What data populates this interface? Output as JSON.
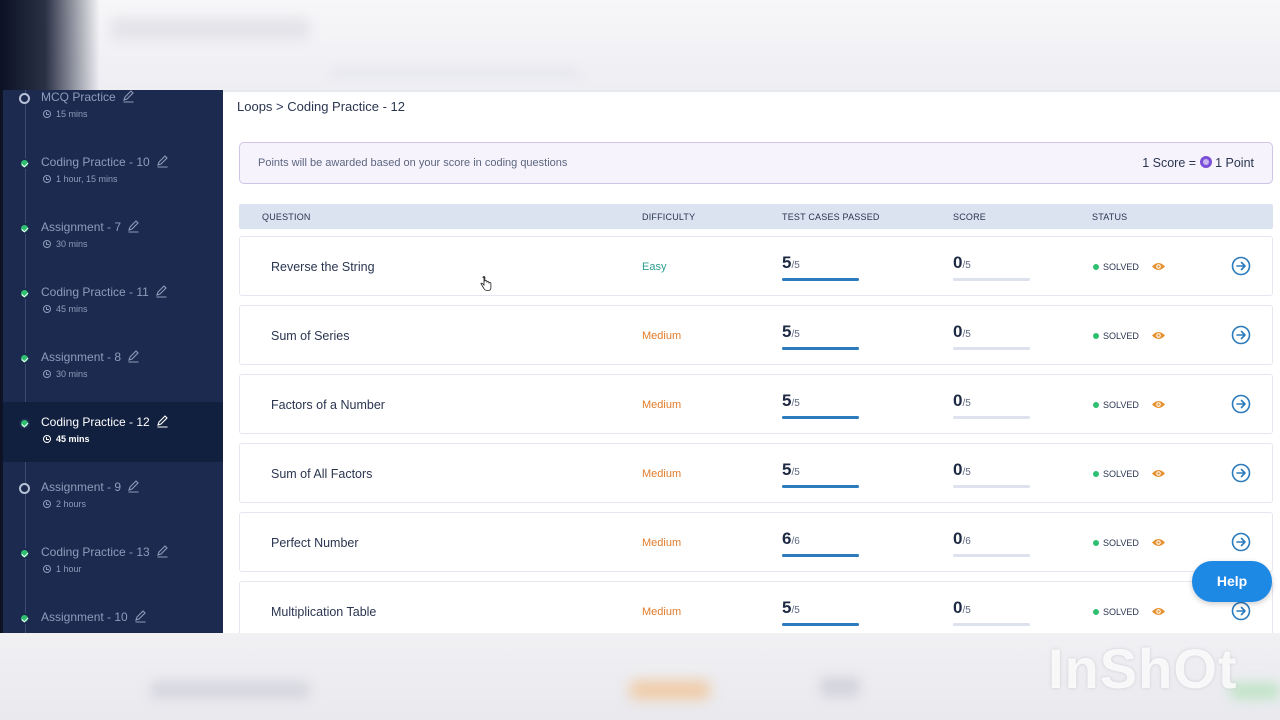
{
  "breadcrumb": "Loops > Coding Practice - 12",
  "banner": {
    "text": "Points will be awarded based on your score in coding questions",
    "score_label": "1 Score =",
    "point_label": "1 Point"
  },
  "sidebar": {
    "items": [
      {
        "title": "MCQ Practice",
        "duration": "15 mins",
        "status": "todo"
      },
      {
        "title": "Coding Practice - 10",
        "duration": "1 hour, 15 mins",
        "status": "done"
      },
      {
        "title": "Assignment - 7",
        "duration": "30 mins",
        "status": "done"
      },
      {
        "title": "Coding Practice - 11",
        "duration": "45 mins",
        "status": "done"
      },
      {
        "title": "Assignment - 8",
        "duration": "30 mins",
        "status": "done"
      },
      {
        "title": "Coding Practice - 12",
        "duration": "45 mins",
        "status": "done",
        "active": true
      },
      {
        "title": "Assignment - 9",
        "duration": "2 hours",
        "status": "todo"
      },
      {
        "title": "Coding Practice - 13",
        "duration": "1 hour",
        "status": "done"
      },
      {
        "title": "Assignment - 10",
        "duration": "",
        "status": "done"
      }
    ]
  },
  "table": {
    "headers": {
      "question": "QUESTION",
      "difficulty": "DIFFICULTY",
      "test_cases": "TEST CASES PASSED",
      "score": "SCORE",
      "status": "STATUS"
    },
    "rows": [
      {
        "name": "Reverse the String",
        "difficulty": "Easy",
        "passed": "5",
        "total": "/5",
        "score": "0",
        "score_total": "/5",
        "passed_fraction": 1.0,
        "score_fraction": 0,
        "status": "SOLVED"
      },
      {
        "name": "Sum of Series",
        "difficulty": "Medium",
        "passed": "5",
        "total": "/5",
        "score": "0",
        "score_total": "/5",
        "passed_fraction": 1.0,
        "score_fraction": 0,
        "status": "SOLVED"
      },
      {
        "name": "Factors of a Number",
        "difficulty": "Medium",
        "passed": "5",
        "total": "/5",
        "score": "0",
        "score_total": "/5",
        "passed_fraction": 1.0,
        "score_fraction": 0,
        "status": "SOLVED"
      },
      {
        "name": "Sum of All Factors",
        "difficulty": "Medium",
        "passed": "5",
        "total": "/5",
        "score": "0",
        "score_total": "/5",
        "passed_fraction": 1.0,
        "score_fraction": 0,
        "status": "SOLVED"
      },
      {
        "name": "Perfect Number",
        "difficulty": "Medium",
        "passed": "6",
        "total": "/6",
        "score": "0",
        "score_total": "/6",
        "passed_fraction": 1.0,
        "score_fraction": 0,
        "status": "SOLVED"
      },
      {
        "name": "Multiplication Table",
        "difficulty": "Medium",
        "passed": "5",
        "total": "/5",
        "score": "0",
        "score_total": "/5",
        "passed_fraction": 1.0,
        "score_fraction": 0,
        "status": "SOLVED"
      }
    ]
  },
  "help_label": "Help",
  "watermark": "InShOt",
  "colors": {
    "sidebar_bg": "#1b2a4e",
    "easy": "#2f9e8f",
    "medium": "#e07b2a",
    "solved": "#2fbf71",
    "progress": "#2b7bbd",
    "eye": "#e6912f",
    "help": "#1e88e5"
  },
  "icons": [
    "edit-icon",
    "clock-icon",
    "coin-icon",
    "eye-icon",
    "arrow-circle-right-icon",
    "hand-cursor-icon"
  ]
}
